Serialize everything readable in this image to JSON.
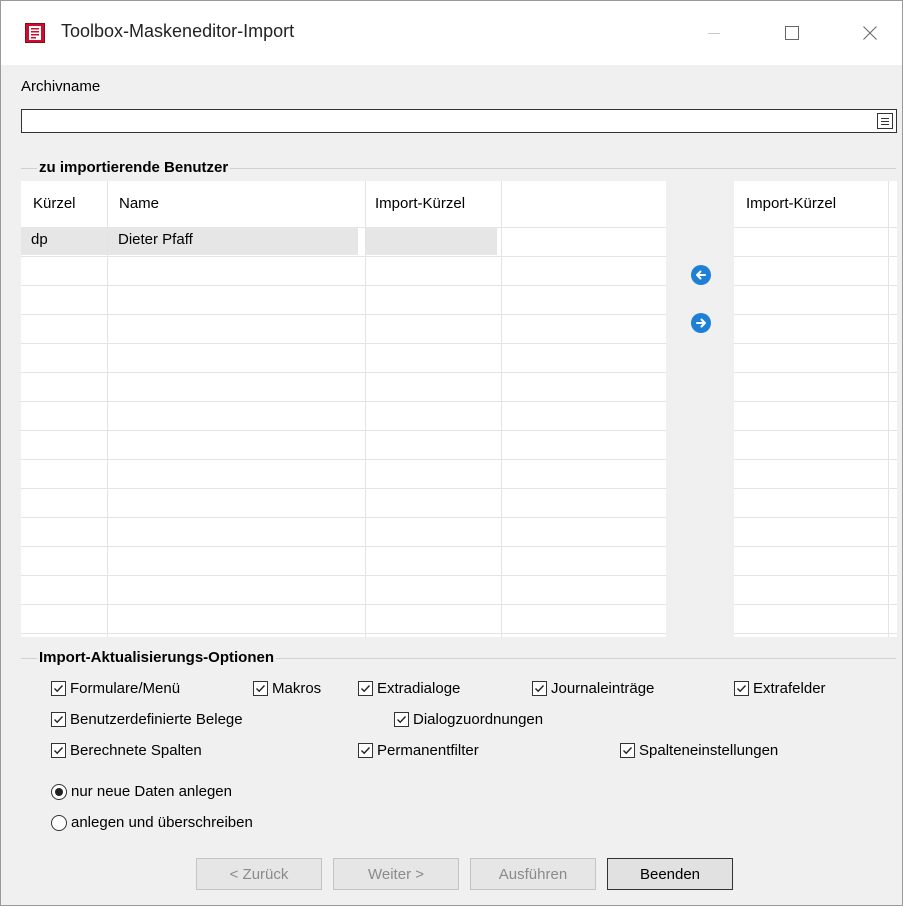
{
  "window": {
    "title": "Toolbox-Maskeneditor-Import"
  },
  "archive": {
    "label": "Archivname",
    "value": ""
  },
  "users_group": {
    "title": "zu importierende Benutzer",
    "columns": [
      "Kürzel",
      "Name",
      "Import-Kürzel"
    ],
    "rows": [
      {
        "kuerzel": "dp",
        "name": "Dieter Pfaff",
        "import_kuerzel": ""
      }
    ],
    "target_header": "Import-Kürzel"
  },
  "options_group": {
    "title": "Import-Aktualisierungs-Optionen",
    "checkboxes": {
      "formulare": {
        "label": "Formulare/Menü",
        "checked": true
      },
      "makros": {
        "label": "Makros",
        "checked": true
      },
      "extradialoge": {
        "label": "Extradialoge",
        "checked": true
      },
      "journaleintraege": {
        "label": "Journaleinträge",
        "checked": true
      },
      "extrafelder": {
        "label": "Extrafelder",
        "checked": true
      },
      "benutzerbelege": {
        "label": "Benutzerdefinierte Belege",
        "checked": true
      },
      "dialogzuordnungen": {
        "label": "Dialogzuordnungen",
        "checked": true
      },
      "berechnete": {
        "label": "Berechnete Spalten",
        "checked": true
      },
      "permanentfilter": {
        "label": "Permanentfilter",
        "checked": true
      },
      "spalteneinstellungen": {
        "label": "Spalteneinstellungen",
        "checked": true
      }
    },
    "radios": {
      "nur_neue": {
        "label": "nur neue Daten anlegen",
        "selected": true
      },
      "ueberschreiben": {
        "label": "anlegen und überschreiben",
        "selected": false
      }
    }
  },
  "buttons": {
    "back": {
      "label": "< Zurück",
      "enabled": false
    },
    "next": {
      "label": "Weiter >",
      "enabled": false
    },
    "execute": {
      "label": "Ausführen",
      "enabled": false
    },
    "finish": {
      "label": "Beenden",
      "enabled": true
    }
  },
  "colors": {
    "arrow_button": "#1e7fd6",
    "selected_row": "#e6e6e6"
  }
}
